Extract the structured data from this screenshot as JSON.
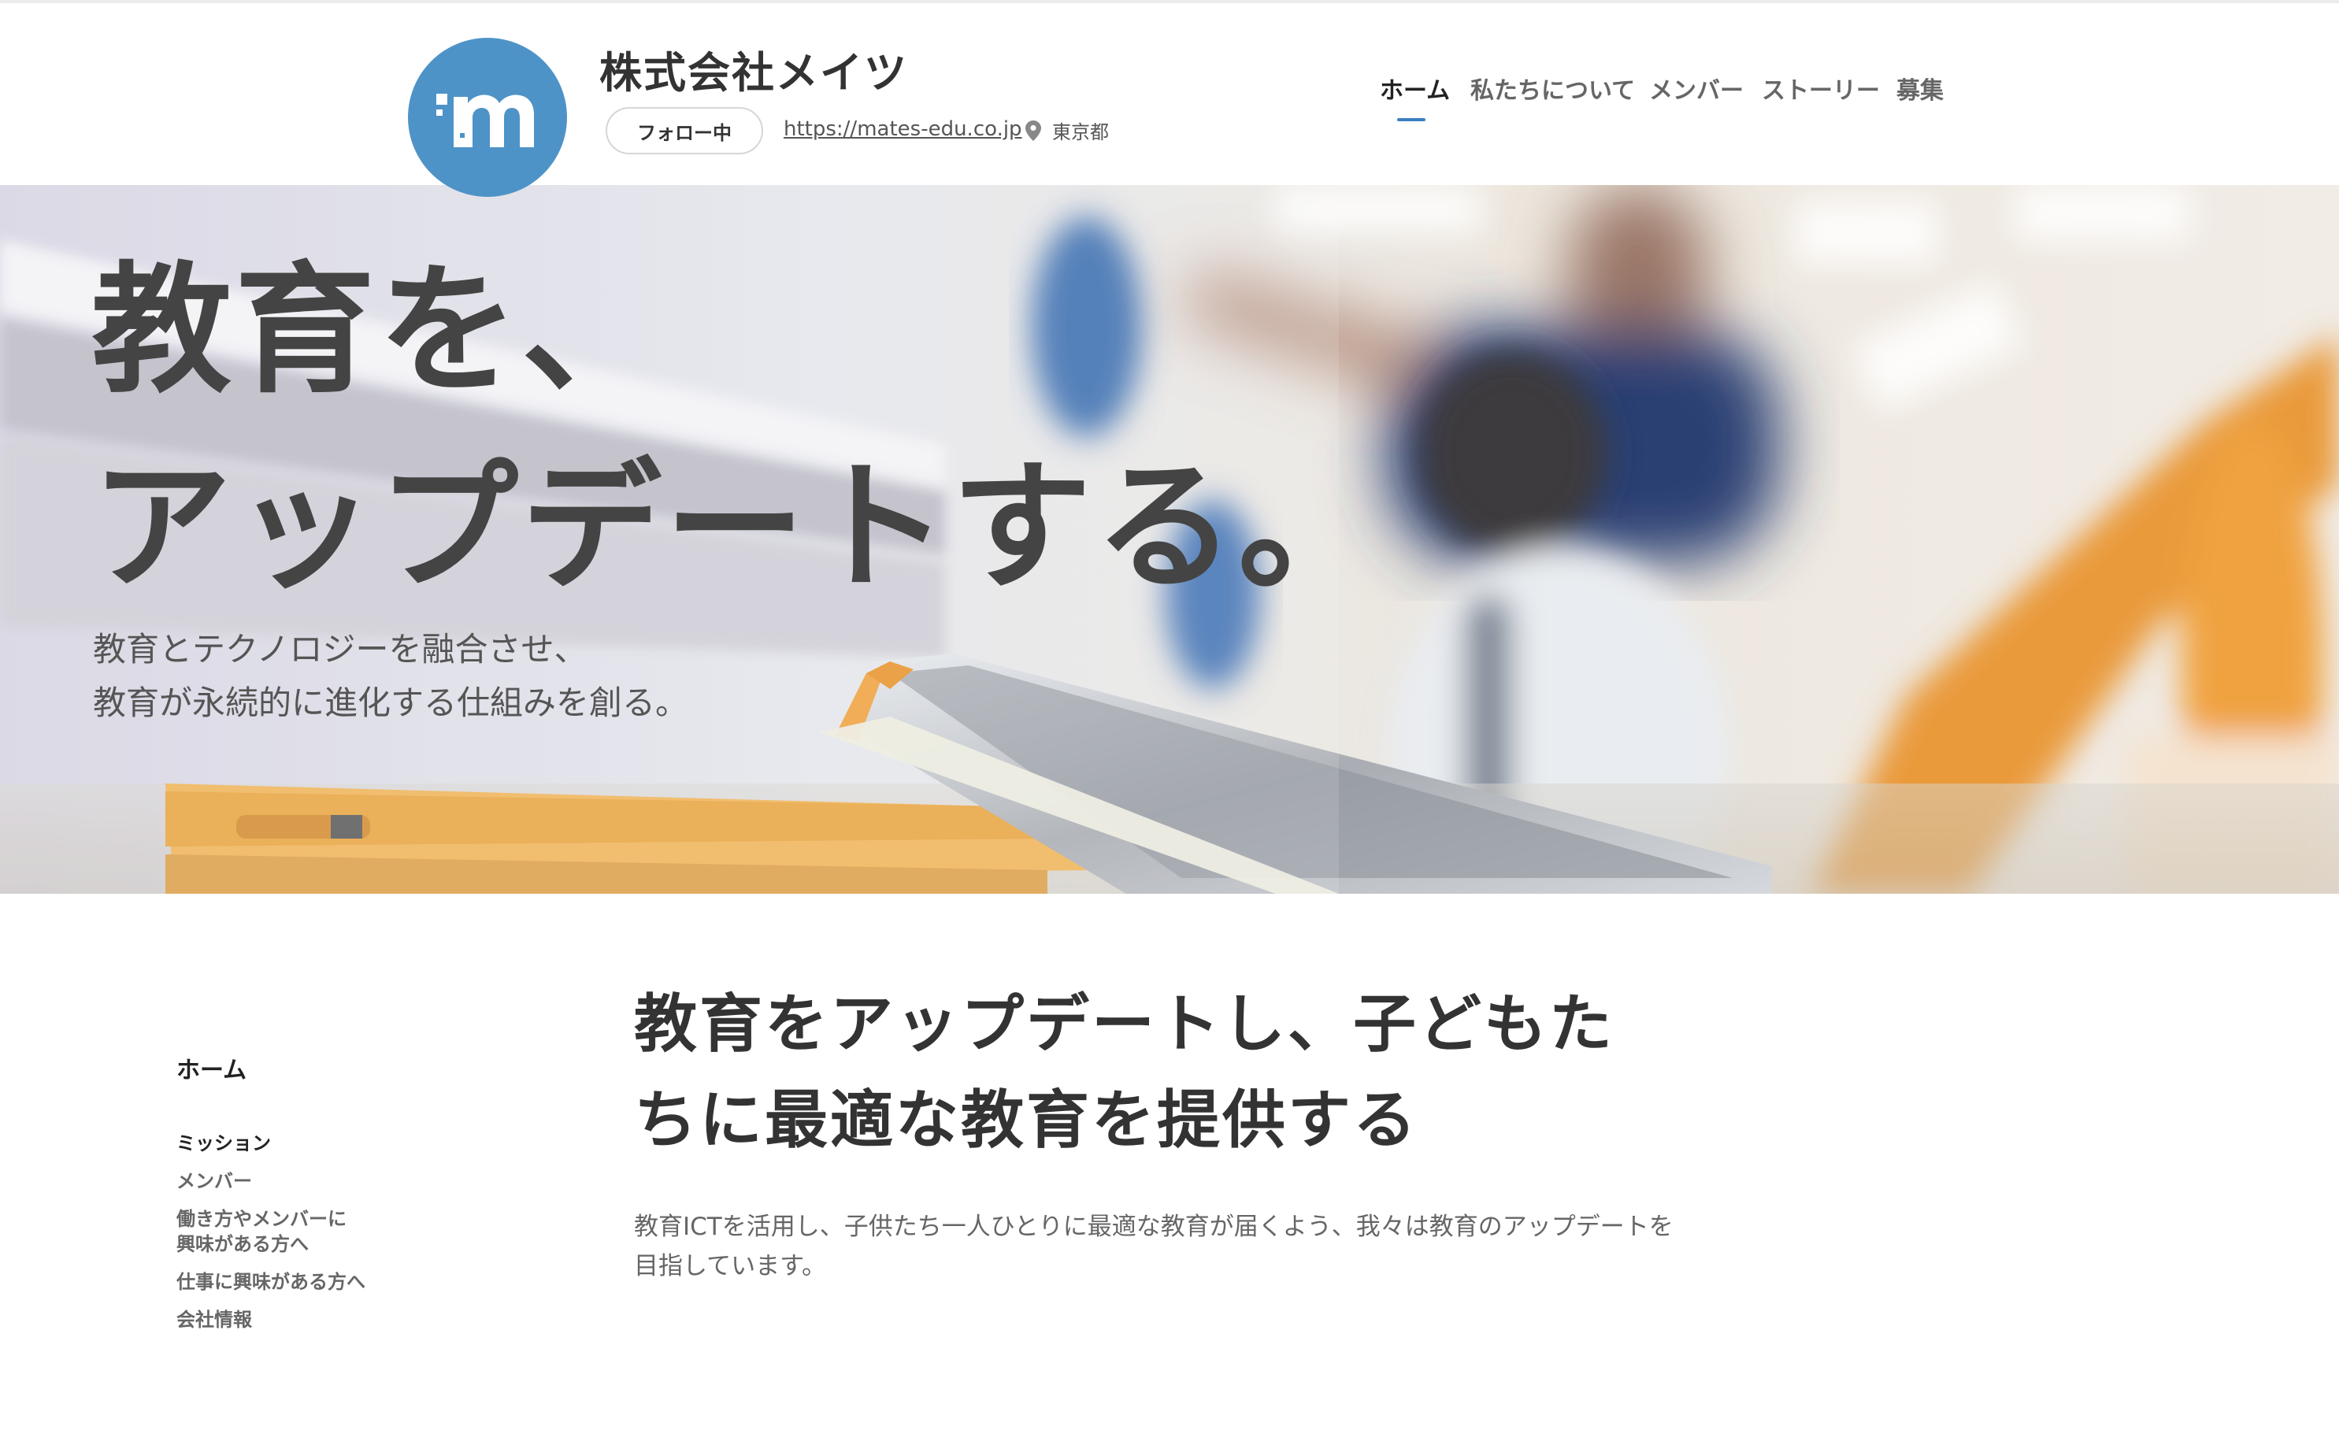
{
  "header": {
    "company_name": "株式会社メイツ",
    "logo_alt": "m",
    "follow_label": "フォロー中",
    "website": "https://mates-edu.co.jp",
    "location": "東京都",
    "brand_color": "#4e93c7"
  },
  "nav": {
    "items": [
      {
        "label": "ホーム",
        "active": true
      },
      {
        "label": "私たちについて",
        "active": false
      },
      {
        "label": "メンバー",
        "active": false
      },
      {
        "label": "ストーリー",
        "active": false
      },
      {
        "label": "募集",
        "active": false
      }
    ],
    "accent_color": "#3a7fc0"
  },
  "hero": {
    "title_line1": "教育を、",
    "title_line2": "アップデートする。",
    "subtitle_line1": "教育とテクノロジーを融合させ、",
    "subtitle_line2": "教育が永続的に進化する仕組みを創る。"
  },
  "sidebar": {
    "home": "ホーム",
    "items": [
      {
        "label": "ミッション"
      },
      {
        "label": "メンバー"
      },
      {
        "label_line1": "働き方やメンバーに",
        "label_line2": "興味がある方へ"
      },
      {
        "label": "仕事に興味がある方へ"
      },
      {
        "label": "会社情報"
      }
    ]
  },
  "main": {
    "heading_line1": "教育をアップデートし、子どもた",
    "heading_line2": "ちに最適な教育を提供する",
    "body_line1": "教育ICTを活用し、子供たち一人ひとりに最適な教育が届くよう、我々は教育のアップデートを",
    "body_line2": "目指しています。"
  }
}
